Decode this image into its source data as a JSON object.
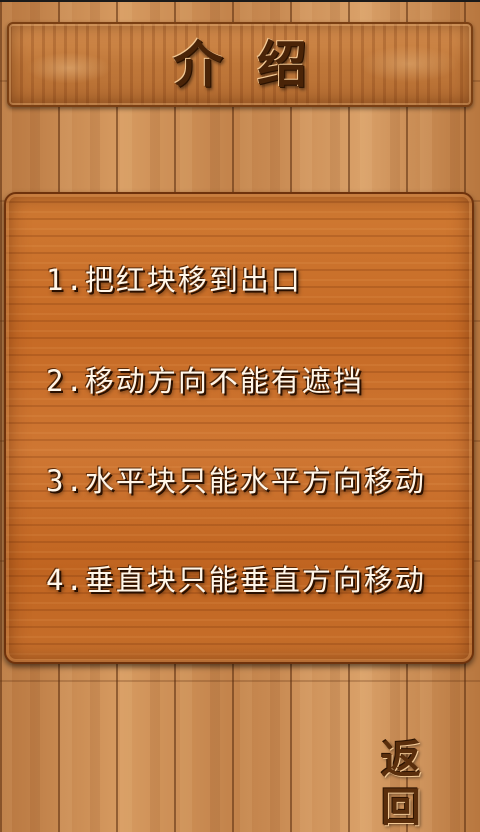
{
  "header": {
    "title": "介绍"
  },
  "rules": [
    "1.把红块移到出口",
    "2.移动方向不能有遮挡",
    "3.水平块只能水平方向移动",
    "4.垂直块只能垂直方向移动"
  ],
  "footer": {
    "back_label": "返回"
  },
  "colors": {
    "wood_light": "#d69a60",
    "panel_orange": "#c96a26",
    "title_text": "#4a2408",
    "rule_text": "#fff6e8"
  }
}
